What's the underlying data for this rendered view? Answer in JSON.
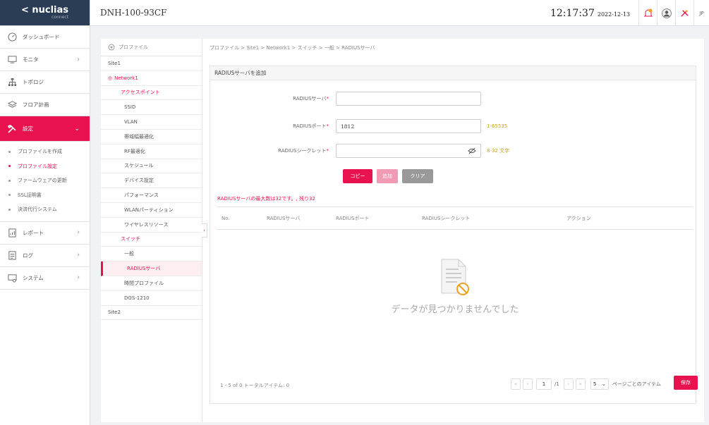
{
  "logo": {
    "brand": "< nuclias",
    "sub": "connect"
  },
  "nav": [
    {
      "label": "ダッシュボード",
      "icon": "dashboard-icon"
    },
    {
      "label": "モニタ",
      "icon": "monitor-icon"
    },
    {
      "label": "トポロジ",
      "icon": "topology-icon"
    },
    {
      "label": "フロア計画",
      "icon": "floor-plan-icon"
    },
    {
      "label": "設定",
      "icon": "settings-tools-icon"
    }
  ],
  "settings_sub": [
    "プロファイルを作成",
    "プロファイル設定",
    "ファームウェアの更新",
    "SSL証明書",
    "決済代行システム"
  ],
  "nav_bottom": [
    {
      "label": "レポート",
      "icon": "report-icon"
    },
    {
      "label": "ログ",
      "icon": "log-icon"
    },
    {
      "label": "システム",
      "icon": "system-icon"
    }
  ],
  "header": {
    "device": "DNH-100-93CF",
    "time": "12:17:37",
    "date": "2022-12-13",
    "lang": "JP"
  },
  "tree": {
    "head": "プロファイル",
    "items": [
      "Site1",
      "Network1",
      "アクセスポイント",
      "SSID",
      "VLAN",
      "帯域幅最適化",
      "RF最適化",
      "スケジュール",
      "デバイス設定",
      "パフォーマンス",
      "WLANパーティション",
      "ワイヤレスリソース",
      "スイッチ",
      "一般",
      "RADIUSサーバ",
      "時間プロファイル",
      "DGS-1210",
      "Site2"
    ]
  },
  "breadcrumb": "プロファイル > Site1 > Network1 > スイッチ > 一般 > RADIUSサーバ",
  "card": {
    "title": "RADIUSサーバを追加"
  },
  "form": {
    "server_label": "RADIUSサーバ",
    "server_value": "",
    "port_label": "RADIUSポート",
    "port_value": "1812",
    "port_hint": "1-65535",
    "secret_label": "RADIUSシークレット",
    "secret_value": "",
    "secret_hint": "8-32 文字",
    "req": "*"
  },
  "buttons": {
    "copy": "コピー",
    "add": "追加",
    "clear": "クリア",
    "save": "保存"
  },
  "max_note": "RADIUSサーバの最大数は32です。, 残り32",
  "table": {
    "columns": [
      "No.",
      "RADIUSサーバ",
      "RADIUSポート",
      "RADIUSシークレット",
      "アクション"
    ],
    "empty": "データが見つかりませんでした"
  },
  "pager": {
    "summary": "1 - 5 of 0 トータルアイテム: 0",
    "first": "«",
    "prev": "‹",
    "next": "›",
    "last": "»",
    "page": "1",
    "total": "/1",
    "per_page": "5",
    "per_page_label": "ページごとのアイテム"
  },
  "colors": {
    "accent": "#e8124f",
    "header_logo_bg": "#2a3d55"
  }
}
